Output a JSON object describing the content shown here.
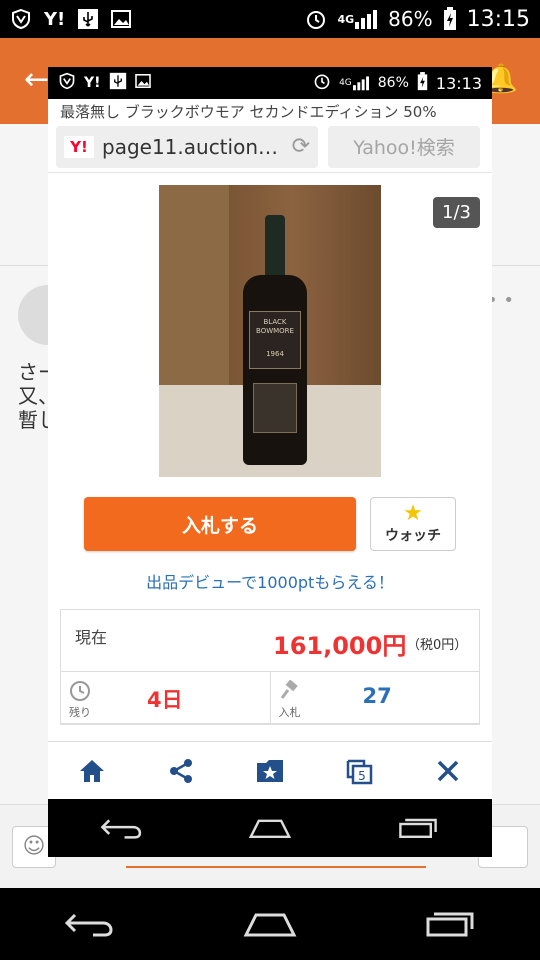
{
  "status": {
    "battery": "86%",
    "time": "13:15",
    "network": "4G"
  },
  "inner_status": {
    "battery": "86%",
    "time": "13:13",
    "network": "4G"
  },
  "background_app": {
    "text_lines": [
      "さー",
      "又、",
      "暫し"
    ]
  },
  "browser": {
    "page_title": "最落無し ブラックボウモア セカンドエディション 50%",
    "url": "page11.auction…",
    "search_placeholder": "Yahoo!検索"
  },
  "product": {
    "image_counter": "1/3",
    "bottle_label_line1": "BLACK",
    "bottle_label_line2": "BOWMORE",
    "bottle_label_line3": "1964",
    "bid_button": "入札する",
    "watch_button": "ウォッチ",
    "promo_text": "出品デビューで1000ptもらえる！",
    "current_label": "現在",
    "current_price": "161,000円",
    "tax_note": "（税0円）",
    "remaining_label": "残り",
    "remaining_value": "4日",
    "bids_label": "入札",
    "bids_value": "27"
  },
  "icons": {
    "home": "home-icon",
    "share": "share-icon",
    "bookmark": "bookmark-star-icon",
    "tabs": "tabs-icon",
    "close": "close-icon"
  },
  "colors": {
    "accent_orange": "#f16a1e",
    "price_red": "#ee3333",
    "link_blue": "#2a6fb8",
    "toolbar_icon": "#234f8a"
  }
}
